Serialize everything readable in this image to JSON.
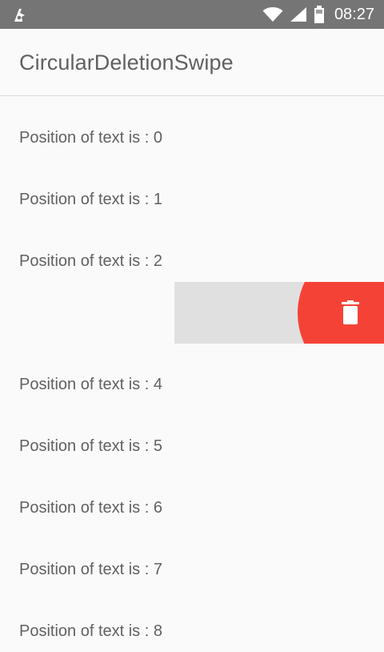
{
  "status_bar": {
    "time": "08:27",
    "icons": [
      "notification-app-icon",
      "wifi-icon",
      "signal-icon",
      "battery-icon"
    ]
  },
  "app_bar": {
    "title": "CircularDeletionSwipe"
  },
  "list": {
    "items": [
      {
        "label": "Position of text is : 0"
      },
      {
        "label": "Position of text is : 1"
      },
      {
        "label": "Position of text is : 2"
      },
      {
        "label": "",
        "swiping": true,
        "action_icon": "trash-icon"
      },
      {
        "label": "Position of text is : 4"
      },
      {
        "label": "Position of text is : 5"
      },
      {
        "label": "Position of text is : 6"
      },
      {
        "label": "Position of text is : 7"
      },
      {
        "label": "Position of text is : 8"
      }
    ]
  },
  "colors": {
    "status_bar": "#757575",
    "background": "#fafafa",
    "text": "#616161",
    "swipe_background": "#e0e0e0",
    "delete_accent": "#f44336"
  }
}
